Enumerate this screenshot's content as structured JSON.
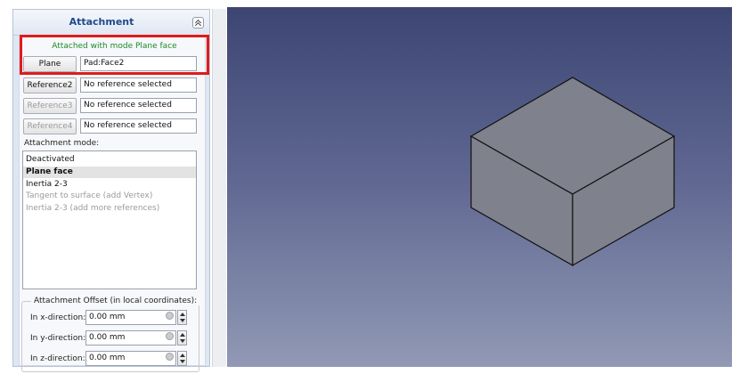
{
  "panel": {
    "title": "Attachment",
    "status": "Attached with mode Plane face",
    "references": [
      {
        "button": "Plane",
        "value": "Pad:Face2",
        "enabled": true
      },
      {
        "button": "Reference2",
        "value": "No reference selected",
        "enabled": true
      },
      {
        "button": "Reference3",
        "value": "No reference selected",
        "enabled": false
      },
      {
        "button": "Reference4",
        "value": "No reference selected",
        "enabled": false
      }
    ],
    "mode_label": "Attachment mode:",
    "modes": [
      {
        "label": "Deactivated",
        "state": "normal"
      },
      {
        "label": "Plane face",
        "state": "selected"
      },
      {
        "label": "Inertia 2-3",
        "state": "normal"
      },
      {
        "label": "Tangent to surface (add Vertex)",
        "state": "disabled"
      },
      {
        "label": "Inertia 2-3 (add more references)",
        "state": "disabled"
      }
    ],
    "offset": {
      "title": "Attachment Offset (in local coordinates):",
      "rows": [
        {
          "label": "In x-direction:",
          "value": "0.00 mm"
        },
        {
          "label": "In y-direction:",
          "value": "0.00 mm"
        },
        {
          "label": "In z-direction:",
          "value": "0.00 mm"
        }
      ]
    }
  },
  "colors": {
    "highlight": "#e01b1b",
    "status_text": "#1b8a26",
    "title_text": "#1f4a8a",
    "viewport_top": "#3d4673",
    "viewport_bottom": "#9199b5",
    "box_face": "#7f818c",
    "box_edge": "#111111"
  },
  "icons": {
    "collapse": "chevron-double-up-icon",
    "expression": "expression-icon",
    "spin": "spin-arrows-icon"
  }
}
